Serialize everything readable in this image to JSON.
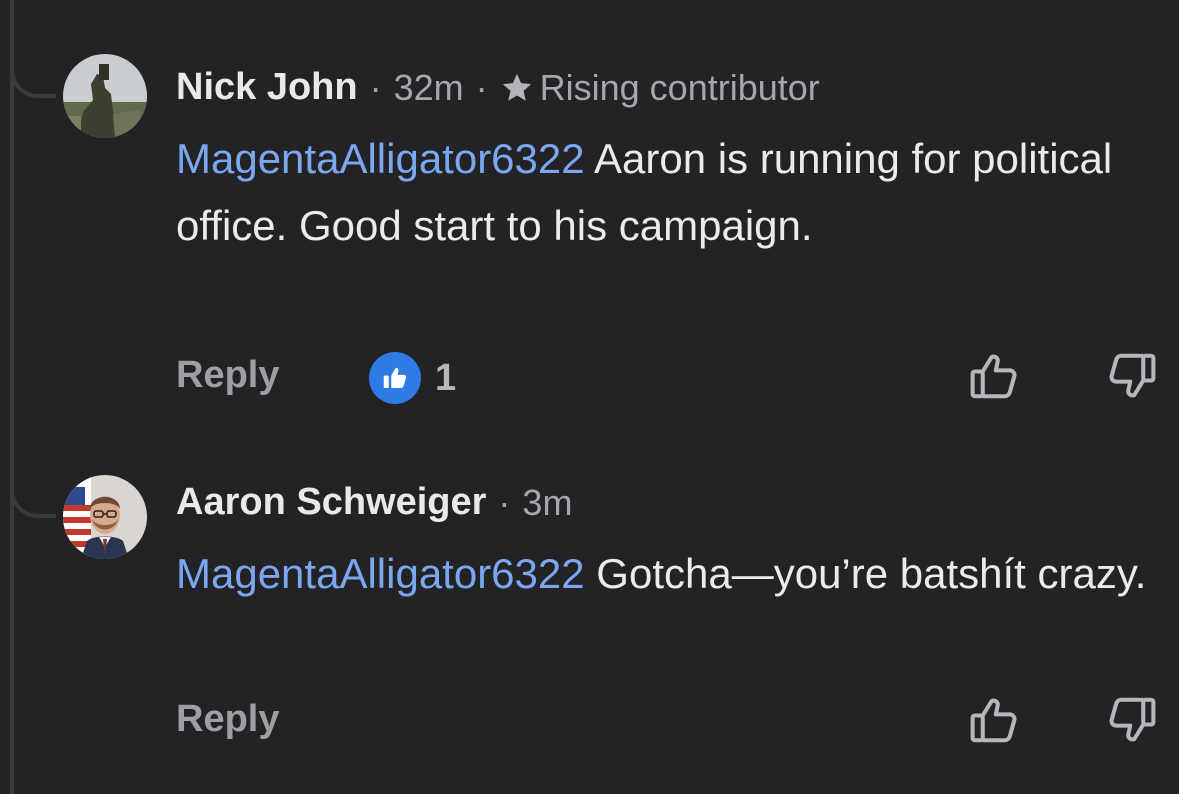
{
  "comments": [
    {
      "author": "Nick John",
      "time": "32m",
      "badge": "Rising contributor",
      "badge_icon": "star-icon",
      "mention": "MagentaAlligator6322",
      "text": " Aaron is running for political office. Good start to his campaign.",
      "reply_label": "Reply",
      "reaction_count": "1"
    },
    {
      "author": "Aaron Schweiger",
      "time": "3m",
      "mention": "MagentaAlligator6322",
      "text": " Gotcha—you’re batshít crazy.",
      "reply_label": "Reply"
    }
  ],
  "colors": {
    "background": "#232325",
    "mention": "#7aa7f0",
    "like_badge": "#2d7be5",
    "meta_text": "#a6a6ab"
  },
  "separator": "·"
}
